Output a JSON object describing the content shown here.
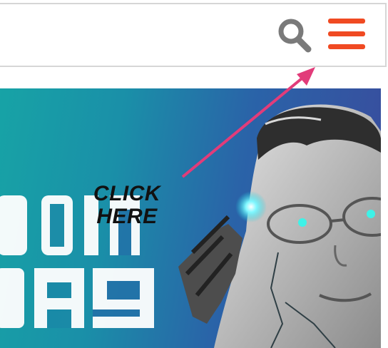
{
  "header": {
    "search_icon": "search-icon",
    "menu_icon": "hamburger-menu-icon",
    "accent_color": "#f04a22",
    "icon_color": "#7a7a7a"
  },
  "banner": {
    "big_text_line1": "OIN",
    "big_text_line2": "DAY",
    "gradient": [
      "#17a3a6",
      "#3b4a9c"
    ]
  },
  "annotation": {
    "line1": "CLICK",
    "line2": "HERE",
    "arrow_color": "#e23c7a"
  }
}
